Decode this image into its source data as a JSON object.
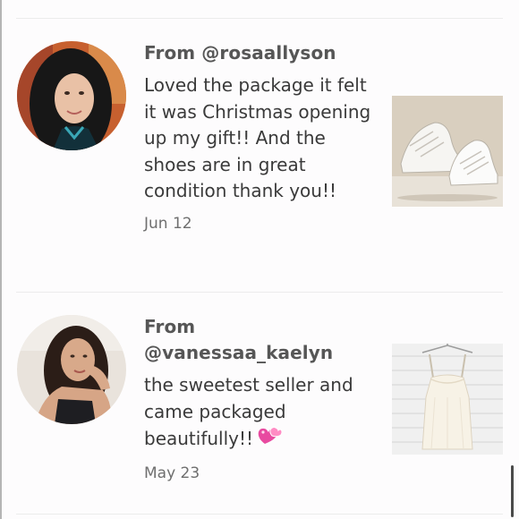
{
  "reviews": [
    {
      "from": "From @rosaallyson",
      "comment": "Loved the package it felt it was Christmas opening up my gift!! And the shoes are in great condition thank you!!",
      "date": "Jun 12",
      "avatar_icon": "user-avatar",
      "thumbnail_icon": "sneakers-photo"
    },
    {
      "from": "From @vanessaa_kaelyn",
      "comment": "the sweetest seller and came packaged beautifully!!",
      "emoji": "💞",
      "date": "May 23",
      "avatar_icon": "user-avatar",
      "thumbnail_icon": "white-dress-photo"
    }
  ],
  "colors": {
    "background": "#fdfcfd",
    "divider": "#ececec",
    "username_text": "#565656",
    "comment_text": "#3a3a3a",
    "date_text": "#6f6f6f",
    "emoji_pink": "#e84aa0"
  }
}
